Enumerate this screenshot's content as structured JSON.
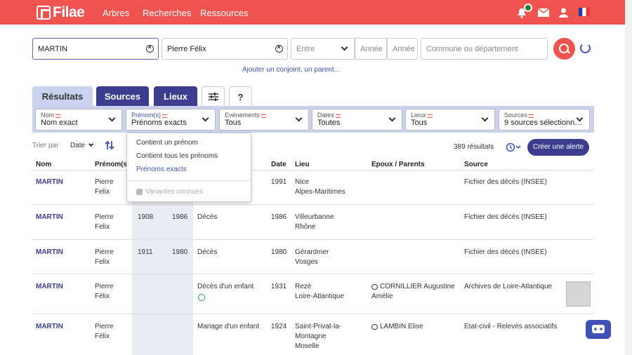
{
  "header": {
    "brand": "Filae",
    "nav": [
      "Arbres",
      "Recherches",
      "Ressources"
    ]
  },
  "search": {
    "surname": "MARTIN",
    "firstname": "Pierre Félix",
    "between_label": "Entre",
    "year_from_placeholder": "Année",
    "year_to_placeholder": "Année",
    "place_placeholder": "Commune ou département",
    "add_link": "Ajouter un conjoint, un parent..."
  },
  "tabs": [
    "Résultats",
    "Sources",
    "Lieux",
    "",
    "?"
  ],
  "filters": [
    {
      "label": "Nom",
      "value": "Nom exact"
    },
    {
      "label": "Prénom(s)",
      "value": "Prénoms exacts"
    },
    {
      "label": "Evénements",
      "value": "Tous"
    },
    {
      "label": "Dates",
      "value": "Toutes"
    },
    {
      "label": "Lieux",
      "value": "Tous"
    },
    {
      "label": "Sources",
      "value": "9 sources sélectionn…"
    }
  ],
  "sort": {
    "label": "Trier par",
    "value": "Date",
    "count": "389 résultats",
    "alert_button": "Créer une alerte"
  },
  "columns": {
    "nom": "Nom",
    "prenoms": "Prénom(s)",
    "date": "Date",
    "lieu": "Lieu",
    "epoux": "Epoux / Parents",
    "source": "Source"
  },
  "dropdown": {
    "options": [
      "Contient un prénom",
      "Contient tous les prénoms",
      "Prénoms exacts"
    ],
    "selected": "Prénoms exacts",
    "checkbox": "Variantes connues"
  },
  "rows": [
    {
      "nom": "MARTIN",
      "prenom1": "Pierre",
      "prenom2": "Felix",
      "b": "",
      "d": "",
      "event": "",
      "date": "1991",
      "lieu1": "Nice",
      "lieu2": "Alpes-Maritimes",
      "epoux1": "",
      "epoux2": "",
      "source": "Fichier des décès (INSEE)"
    },
    {
      "nom": "MARTIN",
      "prenom1": "Pierre",
      "prenom2": "Felix",
      "b": "1908",
      "d": "1986",
      "event": "Décès",
      "date": "1986",
      "lieu1": "Villeurbanne",
      "lieu2": "Rhône",
      "epoux1": "",
      "epoux2": "",
      "source": "Fichier des décès (INSEE)"
    },
    {
      "nom": "MARTIN",
      "prenom1": "Pierre",
      "prenom2": "Felix",
      "b": "1911",
      "d": "1980",
      "event": "Décès",
      "date": "1980",
      "lieu1": "Gérardmer",
      "lieu2": "Vosges",
      "epoux1": "",
      "epoux2": "",
      "source": "Fichier des décès (INSEE)"
    },
    {
      "nom": "MARTIN",
      "prenom1": "Pierre",
      "prenom2": "Félix",
      "b": "",
      "d": "",
      "event": "Décès d'un enfant",
      "date": "1931",
      "lieu1": "Rezé",
      "lieu2": "Loire-Atlantique",
      "epoux1": "CORNILLIER Augustine",
      "epoux2": "Amélie",
      "source": "Archives de Loire-Atlantique"
    },
    {
      "nom": "MARTIN",
      "prenom1": "Pierre",
      "prenom2": "Félix",
      "b": "",
      "d": "",
      "event": "Mariage d'un enfant",
      "date": "1924",
      "lieu1": "Saint-Privat-la-",
      "lieu2": "Montagne",
      "lieu3": "Moselle",
      "epoux1": "LAMBIN Elise",
      "epoux2": "",
      "source": "Etat-civil - Relevés associatifs"
    }
  ]
}
